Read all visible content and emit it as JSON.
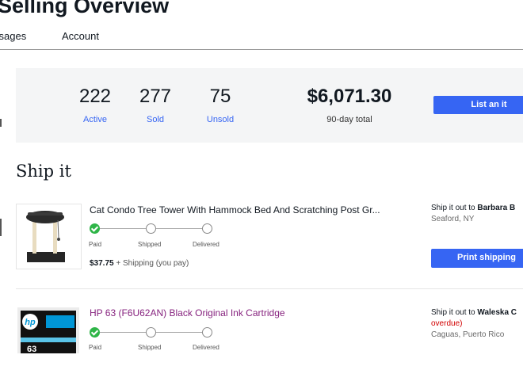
{
  "header": {
    "title": "Selling Overview",
    "tabs": [
      {
        "label": "ssages"
      },
      {
        "label": "Account"
      }
    ]
  },
  "summary": {
    "active": {
      "value": "222",
      "label": "Active"
    },
    "sold": {
      "value": "277",
      "label": "Sold"
    },
    "unsold": {
      "value": "75",
      "label": "Unsold"
    },
    "total": {
      "value": "$6,071.30",
      "label": "90-day total"
    },
    "list_button": "List an it"
  },
  "section": {
    "title": "Ship it"
  },
  "orders": [
    {
      "thumbnail_icon": "cat-tree-image",
      "title": "Cat Condo Tree Tower With Hammock Bed And Scratching Post Gr...",
      "steps": [
        "Paid",
        "Shipped",
        "Delivered"
      ],
      "steps_done": 1,
      "price": "$37.75",
      "shipping_note": "+ Shipping (you pay)",
      "ship_to_prefix": "Ship it out to",
      "buyer": "Barbara B",
      "location": "Seaford, NY",
      "print_button": "Print shipping"
    },
    {
      "thumbnail_icon": "hp-ink-cartridge-image",
      "thumbnail_text": "63",
      "title": "HP 63 (F6U62AN) Black Original Ink Cartridge",
      "steps": [
        "Paid",
        "Shipped",
        "Delivered"
      ],
      "steps_done": 1,
      "ship_to_prefix": "Ship it out to",
      "buyer": "Waleska C",
      "status": "overdue)",
      "location": "Caguas, Puerto Rico"
    }
  ],
  "colors": {
    "accent": "#3665f3",
    "success": "#2fb548",
    "link": "#86227e",
    "alert": "#d10000",
    "panel": "#f4f5f6"
  }
}
